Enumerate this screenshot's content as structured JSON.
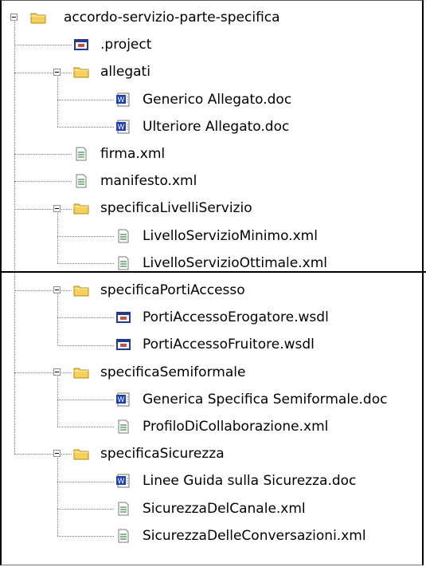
{
  "tree": {
    "root": {
      "label": "accordo-servizio-parte-specifica",
      "type": "folder",
      "expanded": true
    },
    "items": [
      {
        "label": ".project",
        "type": "project-file",
        "level": 1
      },
      {
        "label": "allegati",
        "type": "folder",
        "level": 1,
        "expanded": true
      },
      {
        "label": "Generico Allegato.doc",
        "type": "word-doc",
        "level": 2
      },
      {
        "label": "Ulteriore Allegato.doc",
        "type": "word-doc",
        "level": 2
      },
      {
        "label": "firma.xml",
        "type": "xml-file",
        "level": 1
      },
      {
        "label": "manifesto.xml",
        "type": "xml-file",
        "level": 1
      },
      {
        "label": "specificaLivelliServizio",
        "type": "folder",
        "level": 1,
        "expanded": true
      },
      {
        "label": "LivelloServizioMinimo.xml",
        "type": "xml-file",
        "level": 2
      },
      {
        "label": "LivelloServizioOttimale.xml",
        "type": "xml-file",
        "level": 2
      },
      {
        "label": "specificaPortiAccesso",
        "type": "folder",
        "level": 1,
        "expanded": true
      },
      {
        "label": "PortiAccessoErogatore.wsdl",
        "type": "wsdl-file",
        "level": 2
      },
      {
        "label": "PortiAccessoFruitore.wsdl",
        "type": "wsdl-file",
        "level": 2
      },
      {
        "label": "specificaSemiformale",
        "type": "folder",
        "level": 1,
        "expanded": true
      },
      {
        "label": "Generica Specifica Semiformale.doc",
        "type": "word-doc",
        "level": 2
      },
      {
        "label": "ProfiloDiCollaborazione.xml",
        "type": "xml-file",
        "level": 2
      },
      {
        "label": "specificaSicurezza",
        "type": "folder",
        "level": 1,
        "expanded": true
      },
      {
        "label": "Linee Guida sulla Sicurezza.doc",
        "type": "word-doc",
        "level": 2
      },
      {
        "label": "SicurezzaDelCanale.xml",
        "type": "xml-file",
        "level": 2
      },
      {
        "label": "SicurezzaDelleConversazioni.xml",
        "type": "xml-file",
        "level": 2
      }
    ]
  },
  "colors": {
    "folder": "#f6d05a",
    "folder_edge": "#b38a14",
    "word_blue": "#1f3fae",
    "xml_green": "#3b8f4a",
    "wsdl_frame": "#243a8c"
  }
}
